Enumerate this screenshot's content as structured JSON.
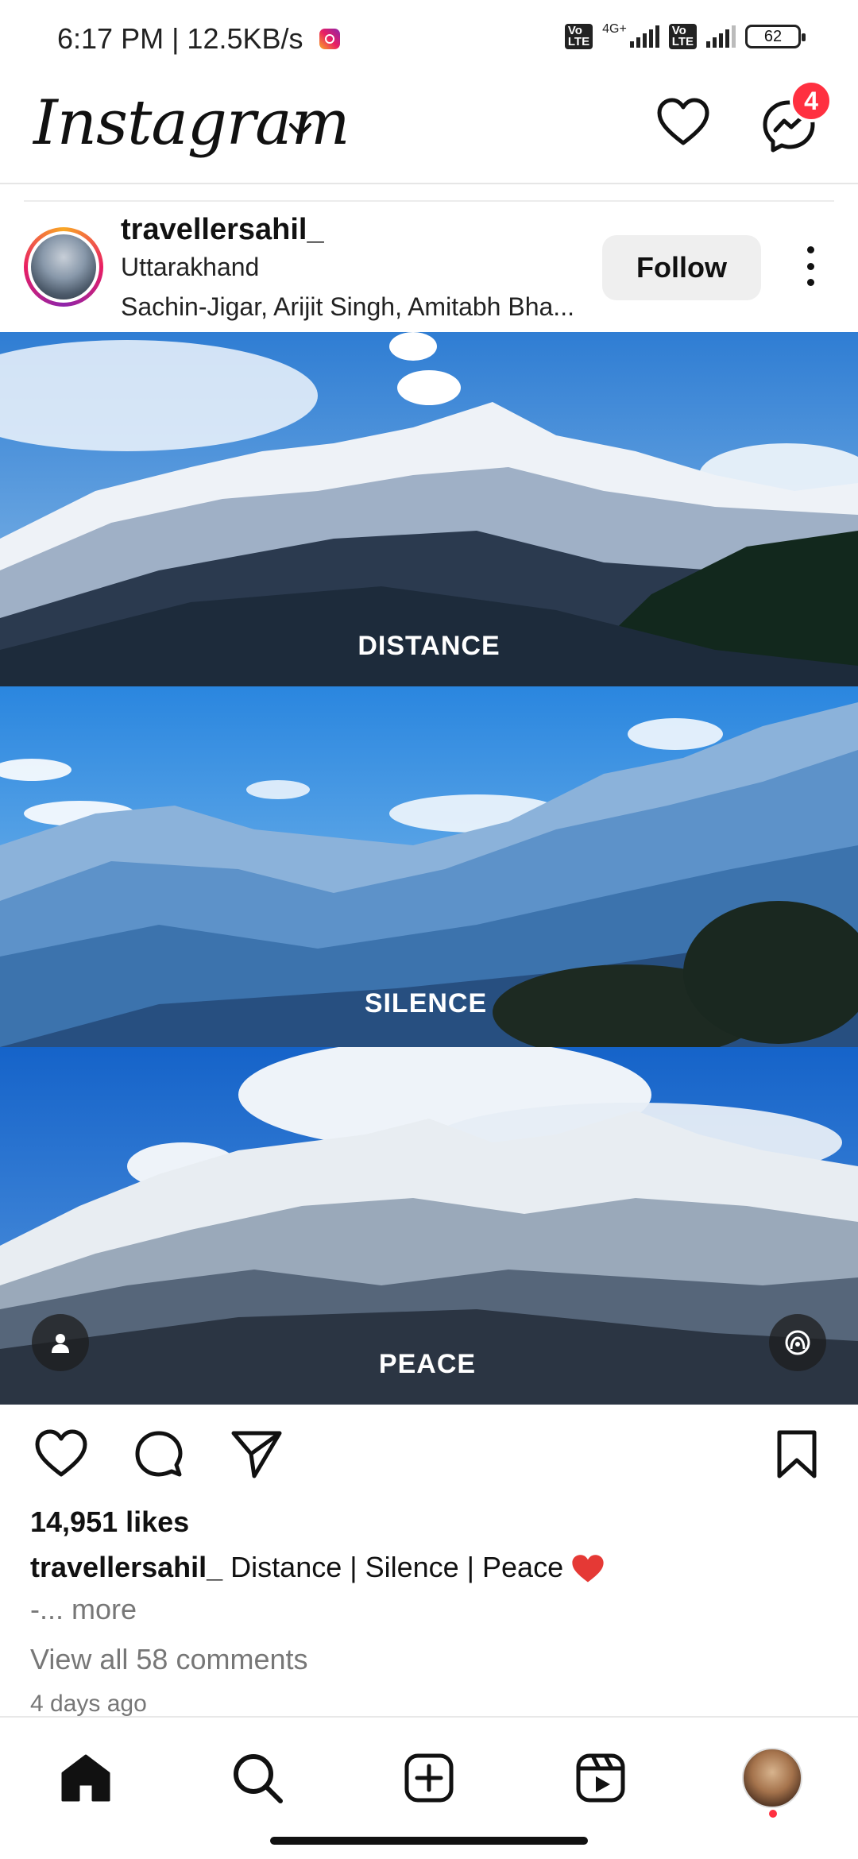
{
  "status_bar": {
    "time": "6:17 PM | 12.5KB/s",
    "network_type": "4G+",
    "volte_label": "Vo LTE",
    "battery": "62"
  },
  "header": {
    "logo_text": "Instagram",
    "messages_badge": "4",
    "icons": [
      "chevron-down-icon",
      "heart-icon",
      "messenger-icon"
    ]
  },
  "post": {
    "username": "travellersahil_",
    "location": "Uttarakhand",
    "audio": "Sachin-Jigar, Arijit Singh, Amitabh Bha...",
    "follow_label": "Follow",
    "panels": [
      {
        "label": "DISTANCE"
      },
      {
        "label": "SILENCE"
      },
      {
        "label": "PEACE"
      }
    ],
    "likes": "14,951 likes",
    "caption_user": "travellersahil_",
    "caption_text": "Distance | Silence | Peace",
    "caption_more": "-... more",
    "view_comments": "View all 58 comments",
    "posted_ago": "4 days ago"
  },
  "bottom_nav": {
    "items": [
      "home-icon",
      "search-icon",
      "create-icon",
      "reels-icon",
      "profile-avatar"
    ]
  },
  "colors": {
    "badge": "#ff3040",
    "sky": "#3d86d6",
    "heart_emoji": "#e53935"
  }
}
